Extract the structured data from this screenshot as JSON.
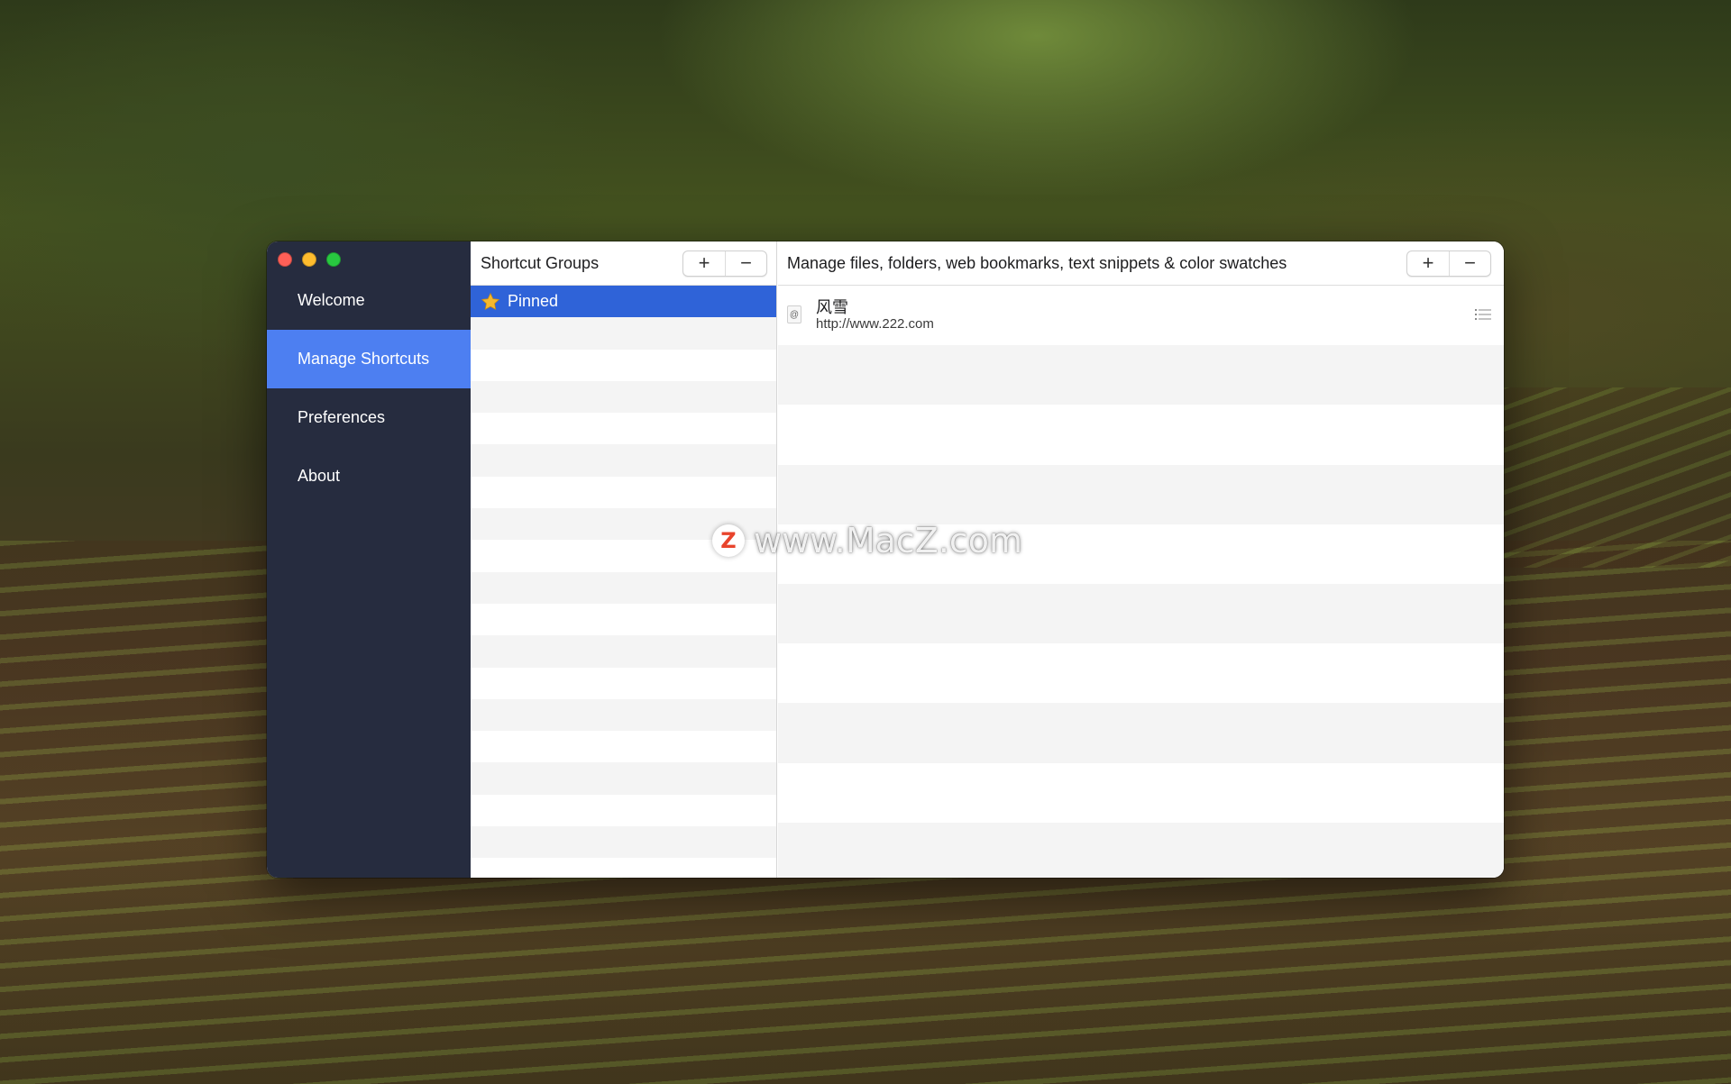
{
  "window": {
    "traffic_lights": [
      "close",
      "minimize",
      "zoom"
    ]
  },
  "sidebar": {
    "items": [
      {
        "label": "Welcome",
        "active": false
      },
      {
        "label": "Manage Shortcuts",
        "active": true
      },
      {
        "label": "Preferences",
        "active": false
      },
      {
        "label": "About",
        "active": false
      }
    ]
  },
  "groups_pane": {
    "title": "Shortcut Groups",
    "add_label": "+",
    "remove_label": "−",
    "items": [
      {
        "label": "Pinned",
        "icon": "star-icon",
        "selected": true
      }
    ]
  },
  "shortcuts_pane": {
    "title": "Manage files, folders, web bookmarks, text snippets & color swatches",
    "add_label": "+",
    "remove_label": "−",
    "items": [
      {
        "title": "风雪",
        "url": "http://www.222.com",
        "icon": "web-location-icon",
        "icon_glyph": "@"
      }
    ]
  },
  "watermark": {
    "logo_letter": "Z",
    "text": "www.MacZ.com"
  },
  "colors": {
    "sidebar_bg": "#262c3f",
    "sidebar_active": "#4d7ff1",
    "selection": "#2f63d8"
  }
}
